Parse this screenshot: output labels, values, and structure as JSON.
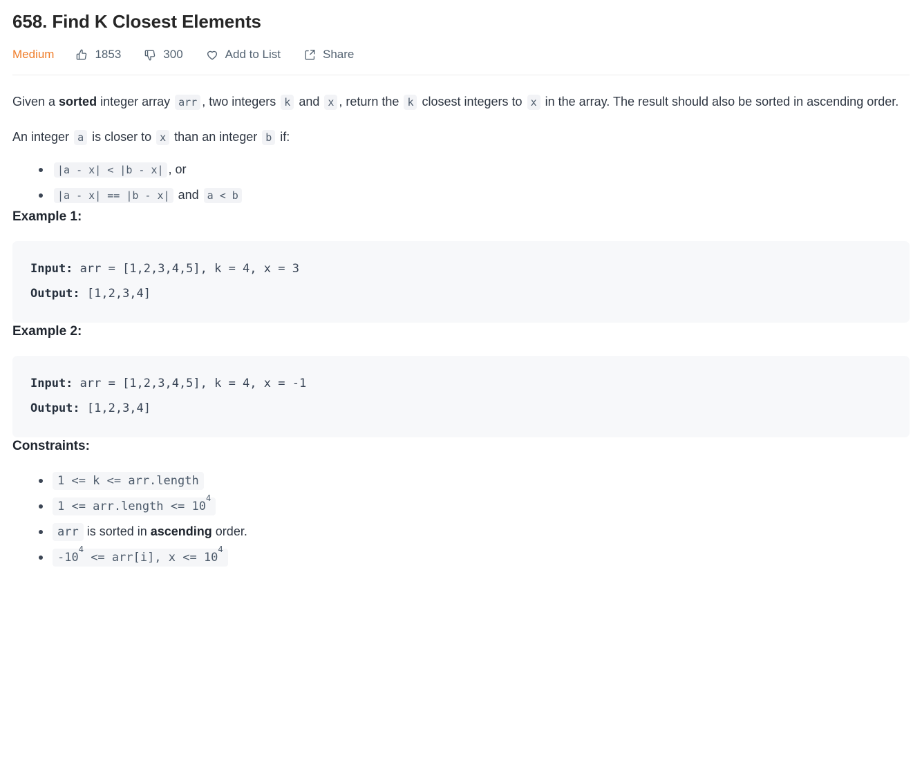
{
  "problem": {
    "title": "658. Find K Closest Elements",
    "difficulty": "Medium",
    "likes": "1853",
    "dislikes": "300",
    "add_to_list_label": "Add to List",
    "share_label": "Share",
    "icons": {
      "like": "thumbs-up-icon",
      "dislike": "thumbs-down-icon",
      "add_to_list": "heart-icon",
      "share": "share-icon"
    },
    "colors": {
      "difficulty_medium": "#ef7c28",
      "body_text": "#2e3642",
      "muted_text": "#546372",
      "inline_code_bg": "#f2f3f6",
      "inline_code_text": "#4d5b6b",
      "codeblock_bg": "#f7f8fa",
      "divider": "#ebebeb"
    }
  },
  "description": {
    "p1": {
      "s1": "Given a ",
      "b1": "sorted",
      "s2": " integer array ",
      "c1": "arr",
      "s3": ", two integers ",
      "c2": "k",
      "s4": " and ",
      "c3": "x",
      "s5": ", return the ",
      "c4": "k",
      "s6": " closest integers to ",
      "c5": "x",
      "s7": " in the array. The result should also be sorted in ascending order."
    },
    "p2": {
      "s1": "An integer ",
      "c1": "a",
      "s2": " is closer to ",
      "c2": "x",
      "s3": " than an integer ",
      "c3": "b",
      "s4": " if:"
    },
    "closer_rules": [
      {
        "code": "|a - x| < |b - x|",
        "tail": ", or"
      },
      {
        "code": "|a - x| == |b - x|",
        "mid": "and",
        "code2": "a < b"
      }
    ]
  },
  "examples": [
    {
      "heading": "Example 1:",
      "input_label": "Input:",
      "input_value": " arr = [1,2,3,4,5], k = 4, x = 3",
      "output_label": "Output:",
      "output_value": " [1,2,3,4]"
    },
    {
      "heading": "Example 2:",
      "input_label": "Input:",
      "input_value": " arr = [1,2,3,4,5], k = 4, x = -1",
      "output_label": "Output:",
      "output_value": " [1,2,3,4]"
    }
  ],
  "constraints": {
    "heading": "Constraints:",
    "items": [
      {
        "type": "code",
        "code": "1 <= k <= arr.length"
      },
      {
        "type": "code_sup",
        "pre": "1 <= arr.length <= 10",
        "sup": "4"
      },
      {
        "type": "mixed",
        "code": "arr",
        "text_a": " is sorted in ",
        "bold": "ascending",
        "text_b": " order."
      },
      {
        "type": "code_sup2",
        "pre": "-10",
        "sup1": "4",
        "mid": " <= arr[i], x <= 10",
        "sup2": "4"
      }
    ]
  }
}
